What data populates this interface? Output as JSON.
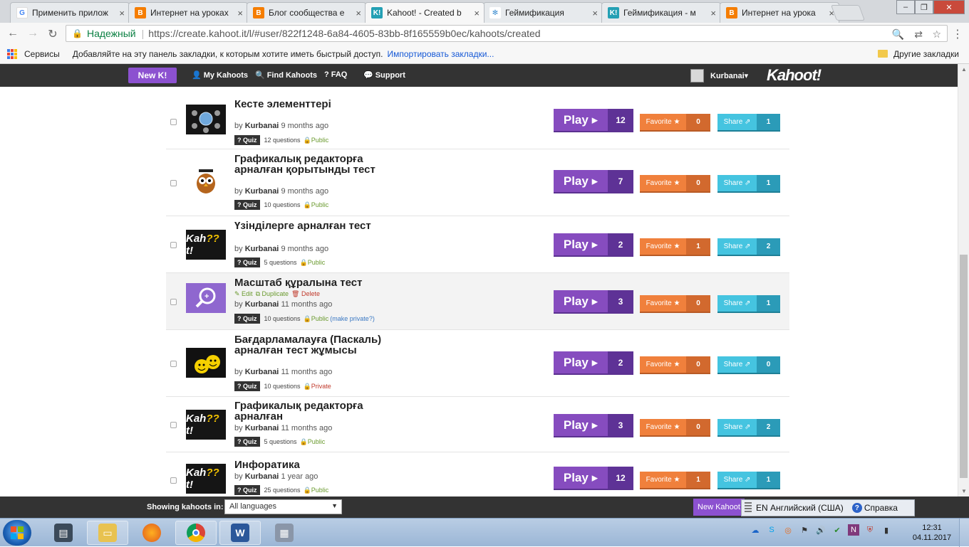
{
  "browser": {
    "tabs": [
      {
        "label": "Применить прилож",
        "favicon": "google-icon",
        "active": false
      },
      {
        "label": "Интернет на уроках",
        "favicon": "blogger-icon",
        "active": false
      },
      {
        "label": "Блог сообщества е",
        "favicon": "blogger-icon",
        "active": false
      },
      {
        "label": "Kahoot! - Created b",
        "favicon": "kahoot-icon",
        "active": true
      },
      {
        "label": "Геймификация",
        "favicon": "slack-icon",
        "active": false
      },
      {
        "label": "Геймификация - м",
        "favicon": "kahoot-icon",
        "active": false
      },
      {
        "label": "Интернет на урока",
        "favicon": "blogger-icon",
        "active": false
      }
    ],
    "tab_close_glyph": "×",
    "window_buttons": {
      "minimize": "–",
      "maximize": "❐",
      "close": "✕"
    },
    "secure_label": "Надежный",
    "url": "https://create.kahoot.it/l/#user/822f1248-6a84-4605-83bb-8f165559b0ec/kahoots/created",
    "bookmarks": {
      "apps_label": "Сервисы",
      "hint": "Добавляйте на эту панель закладки, к которым хотите иметь быстрый доступ.",
      "import_link": "Импортировать закладки...",
      "other": "Другие закладки"
    }
  },
  "kahoot_nav": {
    "new_button": "New K!",
    "links": [
      "My Kahoots",
      "Find Kahoots",
      "FAQ",
      "Support"
    ],
    "username": "Kurbanai▾",
    "logo": "Kahoot!"
  },
  "labels": {
    "by": "by",
    "quiz": "Quiz",
    "questions_suffix": "questions",
    "play": "Play ▸",
    "favorite": "Favorite ★",
    "share": "Share ⇗",
    "edit": "Edit",
    "duplicate": "Duplicate",
    "delete": "Delete",
    "make_private": "(make private?)"
  },
  "kahoots": [
    {
      "title": "Кесте элементтері",
      "user": "Kurbanai",
      "age": "9 months ago",
      "questions": "12",
      "visibility": "Public",
      "plays": "12",
      "favorites": "0",
      "shares": "1",
      "thumb": "globe-thumbnail"
    },
    {
      "title": "Графикалық редакторға арналған қорытынды тест",
      "user": "Kurbanai",
      "age": "9 months ago",
      "questions": "10",
      "visibility": "Public",
      "plays": "7",
      "favorites": "0",
      "shares": "1",
      "thumb": "owl-thumbnail"
    },
    {
      "title": "Үзінділерге арналған тест",
      "user": "Kurbanai",
      "age": "9 months ago",
      "questions": "5",
      "visibility": "Public",
      "plays": "2",
      "favorites": "1",
      "shares": "2",
      "thumb": "kahoot-logo-thumbnail"
    },
    {
      "title": "Масштаб құралына тест",
      "user": "Kurbanai",
      "age": "11 months ago",
      "questions": "10",
      "visibility": "Public",
      "plays": "3",
      "favorites": "0",
      "shares": "1",
      "thumb": "magnifier-thumbnail",
      "hover": true
    },
    {
      "title": "Бағдарламалауға (Паскаль) арналған тест жұмысы",
      "user": "Kurbanai",
      "age": "11 months ago",
      "questions": "10",
      "visibility": "Private",
      "plays": "2",
      "favorites": "0",
      "shares": "0",
      "thumb": "smiley-thumbnail"
    },
    {
      "title": "Графикалық редакторға арналған",
      "user": "Kurbanai",
      "age": "11 months ago",
      "questions": "5",
      "visibility": "Public",
      "plays": "3",
      "favorites": "0",
      "shares": "2",
      "thumb": "kahoot-logo-thumbnail"
    },
    {
      "title": "Инфоратика",
      "user": "Kurbanai",
      "age": "1 year ago",
      "questions": "25",
      "visibility": "Public",
      "plays": "12",
      "favorites": "1",
      "shares": "1",
      "thumb": "kahoot-logo-thumbnail"
    }
  ],
  "footer": {
    "show_label": "Showing kahoots in:",
    "language_value": "All languages",
    "new_kahoot": "New Kahoot"
  },
  "language_bar": {
    "language": "EN Английский (США)",
    "help": "Справка"
  },
  "taskbar": {
    "apps": [
      "scanner-icon",
      "file-explorer-icon",
      "firefox-icon",
      "chrome-icon",
      "word-icon",
      "calculator-icon"
    ],
    "time": "12:31",
    "date": "04.11.2017"
  },
  "colors": {
    "purple": "#864cbf",
    "orange": "#f0803c",
    "teal": "#45c4e0",
    "nav": "#333333"
  }
}
